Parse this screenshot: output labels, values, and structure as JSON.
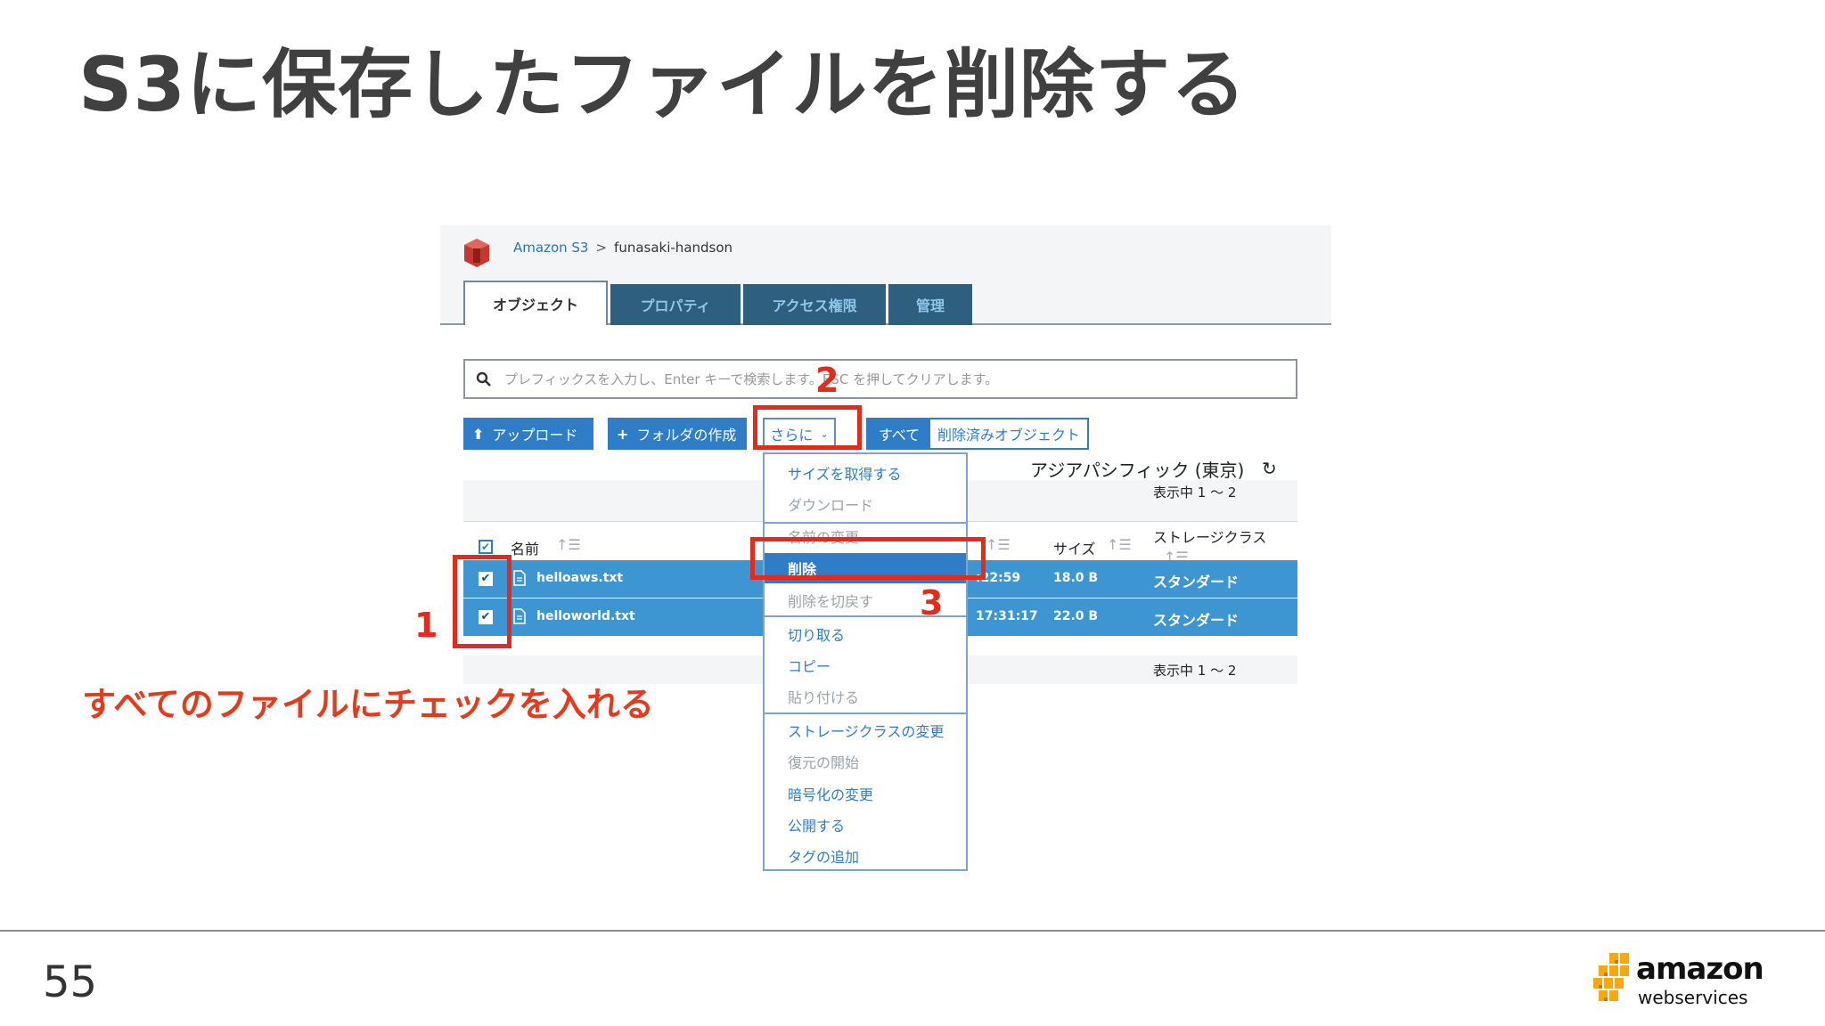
{
  "slide": {
    "title": "S3に保存したファイルを削除する",
    "page_number": "55",
    "callout_text": "すべてのファイルにチェックを入れる",
    "step_labels": [
      "1",
      "2",
      "3"
    ],
    "accent_color": "#e02b1d"
  },
  "console": {
    "breadcrumb": {
      "root": "Amazon S3",
      "separator": ">",
      "current": "funasaki-handson"
    },
    "tabs": [
      {
        "label": "オブジェクト",
        "active": true
      },
      {
        "label": "プロパティ",
        "active": false
      },
      {
        "label": "アクセス権限",
        "active": false
      },
      {
        "label": "管理",
        "active": false
      }
    ],
    "search": {
      "placeholder": "プレフィックスを入力し、Enter キーで検索します。ESC を押してクリアします。"
    },
    "toolbar": {
      "upload_label": "アップロード",
      "create_folder_label": "フォルダの作成",
      "more_label": "さらに",
      "all_label": "すべて",
      "deleted_objects_label": "削除済みオブジェクト"
    },
    "region": "アジアパシフィック (東京)",
    "shown_count": "表示中 1 ～ 2",
    "table": {
      "columns": {
        "name": "名前",
        "size": "サイズ",
        "storage_class": "ストレージクラス"
      },
      "rows": [
        {
          "name": "helloaws.txt",
          "date": ":22:59",
          "size": "18.0 B",
          "storage_class": "スタンダード",
          "checked": true
        },
        {
          "name": "helloworld.txt",
          "date": "17:31:17",
          "size": "22.0 B",
          "storage_class": "スタンダード",
          "checked": true
        }
      ]
    },
    "more_menu": {
      "items": [
        "サイズを取得する",
        "ダウンロード",
        "名前の変更",
        "削除",
        "削除を切戻す",
        "切り取る",
        "コピー",
        "貼り付ける",
        "ストレージクラスの変更",
        "復元の開始",
        "暗号化の変更",
        "公開する",
        "タグの追加"
      ],
      "selected": "削除"
    }
  },
  "brand": {
    "logo_line1": "amazon",
    "logo_line2": "webservices"
  }
}
